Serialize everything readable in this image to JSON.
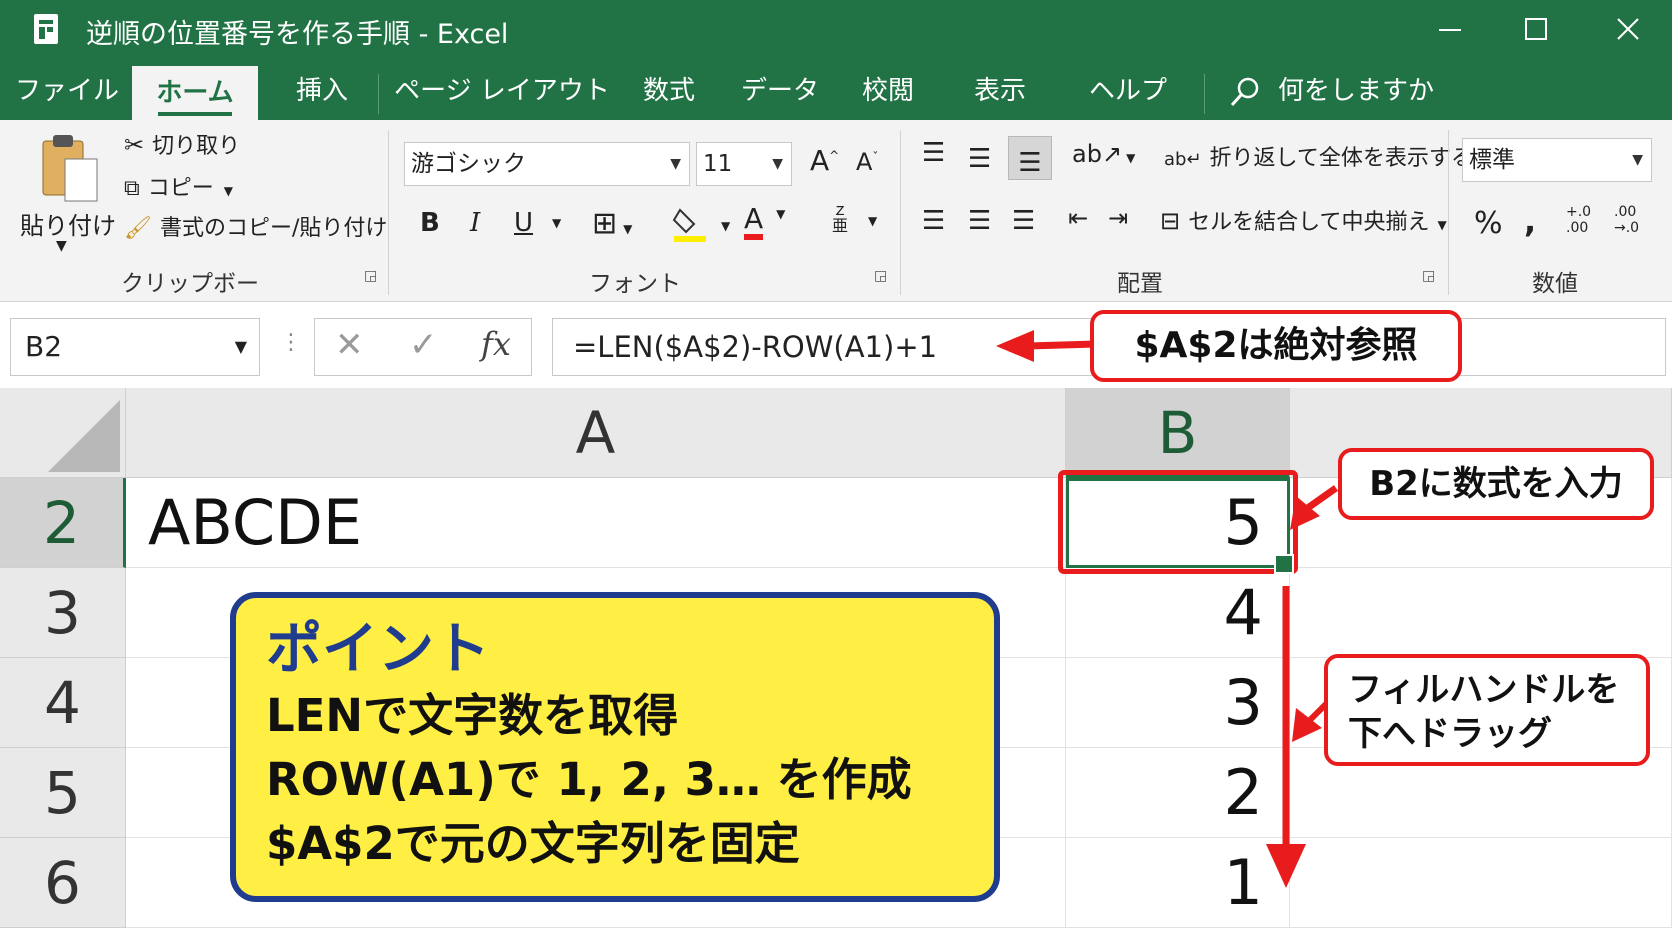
{
  "window": {
    "title": "逆順の位置番号を作る手順  -  Excel",
    "minimize": "—",
    "maximize": "☐",
    "close": "✕"
  },
  "tabs": [
    "ファイル",
    "ホーム",
    "挿入",
    "ページ レイアウト",
    "数式",
    "データ",
    "校閲",
    "表示",
    "ヘルプ"
  ],
  "active_tab": "ホーム",
  "tell_me": "何をしますか",
  "ribbon": {
    "clipboard": {
      "paste": "貼り付け",
      "cut": "切り取り",
      "copy": "コピー",
      "format_painter": "書式のコピー/貼り付け",
      "label": "クリップボード"
    },
    "font": {
      "name": "游ゴシック",
      "size": "11",
      "grow": "A",
      "shrink": "A",
      "bold": "B",
      "italic": "I",
      "underline": "U",
      "font_color_letter": "A",
      "highlight_color": "#ffee00",
      "font_color": "#e81c1c",
      "label": "フォント"
    },
    "alignment": {
      "wrap_text": "折り返して全体を表示する",
      "merge_center": "セルを結合して中央揃え",
      "label": "配置"
    },
    "number": {
      "format": "標準",
      "percent": "%",
      "comma": ",",
      "increase_decimal_top": "+.0",
      "increase_decimal_bottom": ".00",
      "decrease_decimal_top": ".00",
      "decrease_decimal_bottom": "→.0",
      "label": "数値"
    }
  },
  "formula_bar": {
    "name_box": "B2",
    "formula": "=LEN($A$2)-ROW(A1)+1",
    "fx": "fx"
  },
  "grid": {
    "columns": [
      "A",
      "B"
    ],
    "rows": [
      "2",
      "3",
      "4",
      "5",
      "6"
    ],
    "A2": "ABCDE",
    "B_values": [
      "5",
      "4",
      "3",
      "2",
      "1"
    ]
  },
  "annotations": {
    "absolute_ref": "$A$2は絶対参照",
    "enter_formula": "B2に数式を入力",
    "fill_handle_line1": "フィルハンドルを",
    "fill_handle_line2": "下へドラッグ",
    "point_title": "ポイント",
    "point_lines": [
      "LENで文字数を取得",
      "ROW(A1)で 1, 2, 3…  を作成",
      "$A$2で元の文字列を固定"
    ],
    "accent_red": "#e81c1c",
    "point_bg": "#ffee44",
    "point_border": "#1f3c8f"
  },
  "colors": {
    "excel_green": "#217346"
  }
}
